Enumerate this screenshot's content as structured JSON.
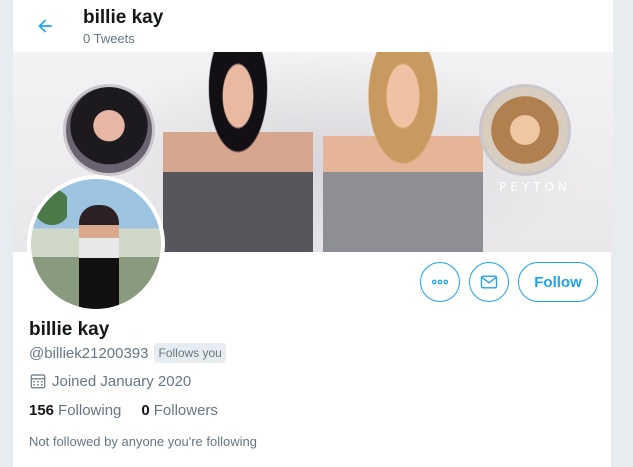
{
  "header": {
    "name": "billie kay",
    "tweets_count": "0 Tweets"
  },
  "banner": {
    "caption": "PEYTON"
  },
  "actions": {
    "follow_label": "Follow"
  },
  "profile": {
    "name": "billie kay",
    "handle": "@billiek21200393",
    "follows_you": "Follows you",
    "joined": "Joined January 2020",
    "following_count": "156",
    "following_label": "Following",
    "followers_count": "0",
    "followers_label": "Followers",
    "not_followed": "Not followed by anyone you're following"
  },
  "icons": {
    "back": "arrow-left-icon",
    "more": "more-dots-icon",
    "message": "envelope-icon",
    "calendar": "calendar-icon"
  },
  "colors": {
    "accent": "#1da1f2",
    "secondary_text": "#657786",
    "primary_text": "#14171a"
  }
}
